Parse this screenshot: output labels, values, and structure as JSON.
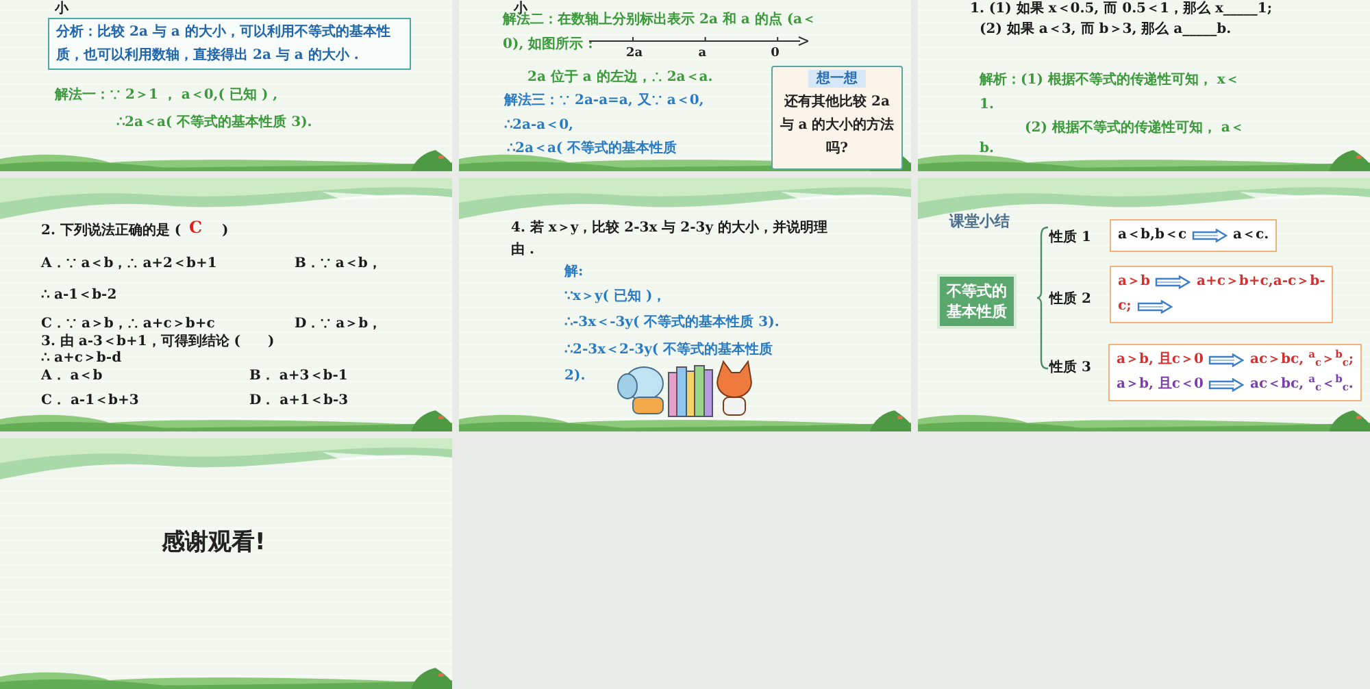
{
  "slides": [
    {
      "items": [
        {
          "kind": "question",
          "text": "小"
        },
        {
          "kind": "analysis-box",
          "text": "分析：比较 2a 与 a 的大小，可以利用不等式的基本性质，也可以利用数轴，直接得出 2a 与 a 的大小 ."
        },
        {
          "kind": "solution",
          "text": "解法一：∵ 2＞1 ， a＜0,( 已知 ) ,"
        },
        {
          "kind": "solution",
          "text": "∴2a＜a( 不等式的基本性质 3)."
        }
      ]
    },
    {
      "items": [
        {
          "kind": "question",
          "text": "小"
        },
        {
          "kind": "solution",
          "text": "解法二：在数轴上分别标出表示 2a 和 a 的点 (a＜"
        },
        {
          "kind": "solution",
          "text": "0), 如图所示 :"
        },
        {
          "kind": "number-line",
          "labels": [
            "2a",
            "a",
            "0"
          ]
        },
        {
          "kind": "solution",
          "text": "2a 位于 a 的左边，∴ 2a＜a."
        },
        {
          "kind": "working",
          "text": "解法三：∵ 2a-a=a, 又∵ a＜0,"
        },
        {
          "kind": "working",
          "text": "∴2a-a＜0,"
        },
        {
          "kind": "working",
          "text": "∴2a＜a( 不等式的基本性质"
        },
        {
          "kind": "callout",
          "title": "想一想",
          "text": "还有其他比较 2a 与 a 的大小的方法吗?"
        }
      ]
    },
    {
      "items": [
        {
          "kind": "question",
          "text": "1. (1) 如果 x＜0.5, 而 0.5＜1，那么 x_____1;"
        },
        {
          "kind": "question",
          "text": "(2) 如果 a＜3, 而 b＞3, 那么 a_____b."
        },
        {
          "kind": "solution",
          "text": "解析：(1) 根据不等式的传递性可知， x＜"
        },
        {
          "kind": "solution",
          "text": "1."
        },
        {
          "kind": "solution",
          "text": "(2) 根据不等式的传递性可知， a＜"
        },
        {
          "kind": "solution",
          "text": "b."
        }
      ]
    },
    {
      "items": [
        {
          "kind": "question",
          "text": "2. 下列说法正确的是 ("
        },
        {
          "kind": "answer",
          "text": "C"
        },
        {
          "kind": "question",
          "text": ")"
        },
        {
          "kind": "question",
          "text": "A．∵ a＜b，∴ a+2＜b+1"
        },
        {
          "kind": "question",
          "text": "B．∵ a＜b，"
        },
        {
          "kind": "question",
          "text": "∴ a-1＜b-2"
        },
        {
          "kind": "question",
          "text": "C．∵ a＞b，∴ a+c＞b+c"
        },
        {
          "kind": "question",
          "text": "D．∵ a＞b，"
        },
        {
          "kind": "question",
          "text": "3. 由 a-3＜b+1，可得到结论 (　　)"
        },
        {
          "kind": "question",
          "text": "∴ a+c＞b-d"
        },
        {
          "kind": "question",
          "text": "A． a＜b"
        },
        {
          "kind": "question",
          "text": "B． a+3＜b-1"
        },
        {
          "kind": "question",
          "text": "C． a-1＜b+3"
        },
        {
          "kind": "question",
          "text": "D． a+1＜b-3"
        }
      ]
    },
    {
      "items": [
        {
          "kind": "question",
          "text": "4. 若 x＞y，比较 2-3x 与 2-3y 的大小，并说明理"
        },
        {
          "kind": "question",
          "text": "由 ."
        },
        {
          "kind": "working",
          "text": "解:"
        },
        {
          "kind": "working",
          "text": "∵x＞y( 已知 )，"
        },
        {
          "kind": "working",
          "text": "∴-3x＜-3y( 不等式的基本性质 3)."
        },
        {
          "kind": "working",
          "text": "∴2-3x＜2-3y( 不等式的基本性质"
        },
        {
          "kind": "working",
          "text": "2)."
        },
        {
          "kind": "illustration"
        }
      ]
    },
    {
      "items": [
        {
          "kind": "heading",
          "text": "课堂小结"
        },
        {
          "kind": "topic-box",
          "text": "不等式的基本性质"
        },
        {
          "kind": "brace"
        },
        {
          "kind": "question",
          "text": "性质 1"
        },
        {
          "kind": "question",
          "text": "性质 2"
        },
        {
          "kind": "question",
          "text": "性质 3"
        },
        {
          "kind": "rule-box",
          "lines": [
            {
              "kind": "plain",
              "parts": [
                {
                  "kind": "text",
                  "text": "a＜b,b＜c"
                },
                {
                  "kind": "arrow"
                },
                {
                  "kind": "text",
                  "text": "a＜c."
                }
              ]
            }
          ]
        },
        {
          "kind": "rule-box",
          "lines": [
            {
              "kind": "positive",
              "parts": [
                {
                  "kind": "text",
                  "text": "a＞b"
                },
                {
                  "kind": "arrow"
                },
                {
                  "kind": "text",
                  "text": "a+c＞b+c,a-c＞b-"
                }
              ]
            },
            {
              "kind": "positive",
              "parts": [
                {
                  "kind": "text",
                  "text": "c;"
                },
                {
                  "kind": "arrow"
                }
              ]
            }
          ]
        },
        {
          "kind": "rule-box",
          "lines": [
            {
              "kind": "positive",
              "parts": [
                {
                  "kind": "text",
                  "text": "a＞b, 且c＞0"
                },
                {
                  "kind": "arrow"
                },
                {
                  "kind": "text",
                  "text": "ac＞bc, $^{a}$$_{c}$＞$^{b}$$_{c}$;"
                }
              ]
            },
            {
              "kind": "negative",
              "parts": [
                {
                  "kind": "text",
                  "text": "a＞b, 且c＜0"
                },
                {
                  "kind": "arrow"
                },
                {
                  "kind": "text",
                  "text": "ac＜bc, $^{a}$$_{c}$＜$^{b}$$_{c}$."
                }
              ]
            }
          ]
        }
      ]
    },
    {
      "items": [
        {
          "kind": "closing",
          "text": "感谢观看!"
        }
      ]
    }
  ]
}
